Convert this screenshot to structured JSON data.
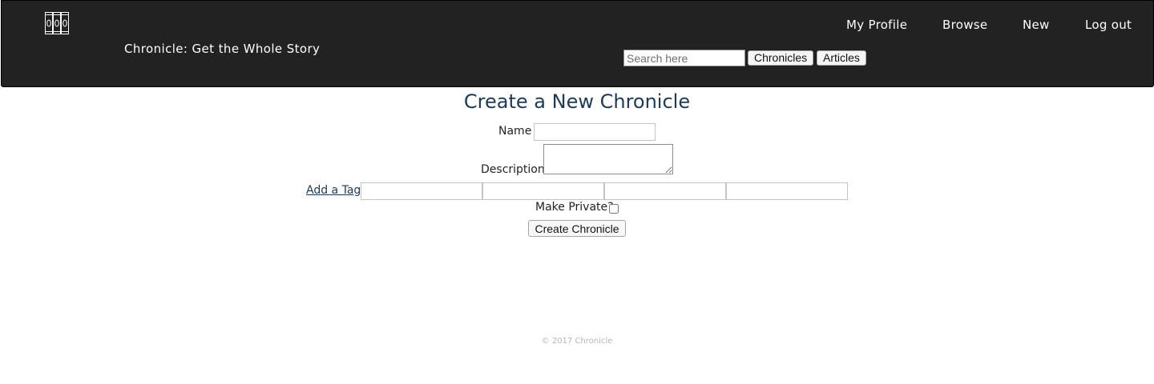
{
  "header": {
    "logo_icon": "bookshelf-icon",
    "tagline": "Chronicle: Get the Whole Story",
    "nav": {
      "profile": "My Profile",
      "browse": "Browse",
      "new": "New",
      "logout": "Log out"
    },
    "search": {
      "placeholder": "Search here",
      "value": "",
      "chronicles_label": "Chronicles",
      "articles_label": "Articles"
    },
    "background_color": "#222222"
  },
  "form": {
    "title": "Create a New Chronicle",
    "name_label": "Name",
    "name_value": "",
    "description_label": "Description",
    "description_value": "",
    "add_tag_label": "Add a Tag",
    "tags": [
      "",
      "",
      "",
      ""
    ],
    "private_label": "Make Private?",
    "private_checked": false,
    "submit_label": "Create Chronicle",
    "title_color": "#1d3a57"
  },
  "footer": {
    "copyright": "© 2017 Chronicle"
  }
}
